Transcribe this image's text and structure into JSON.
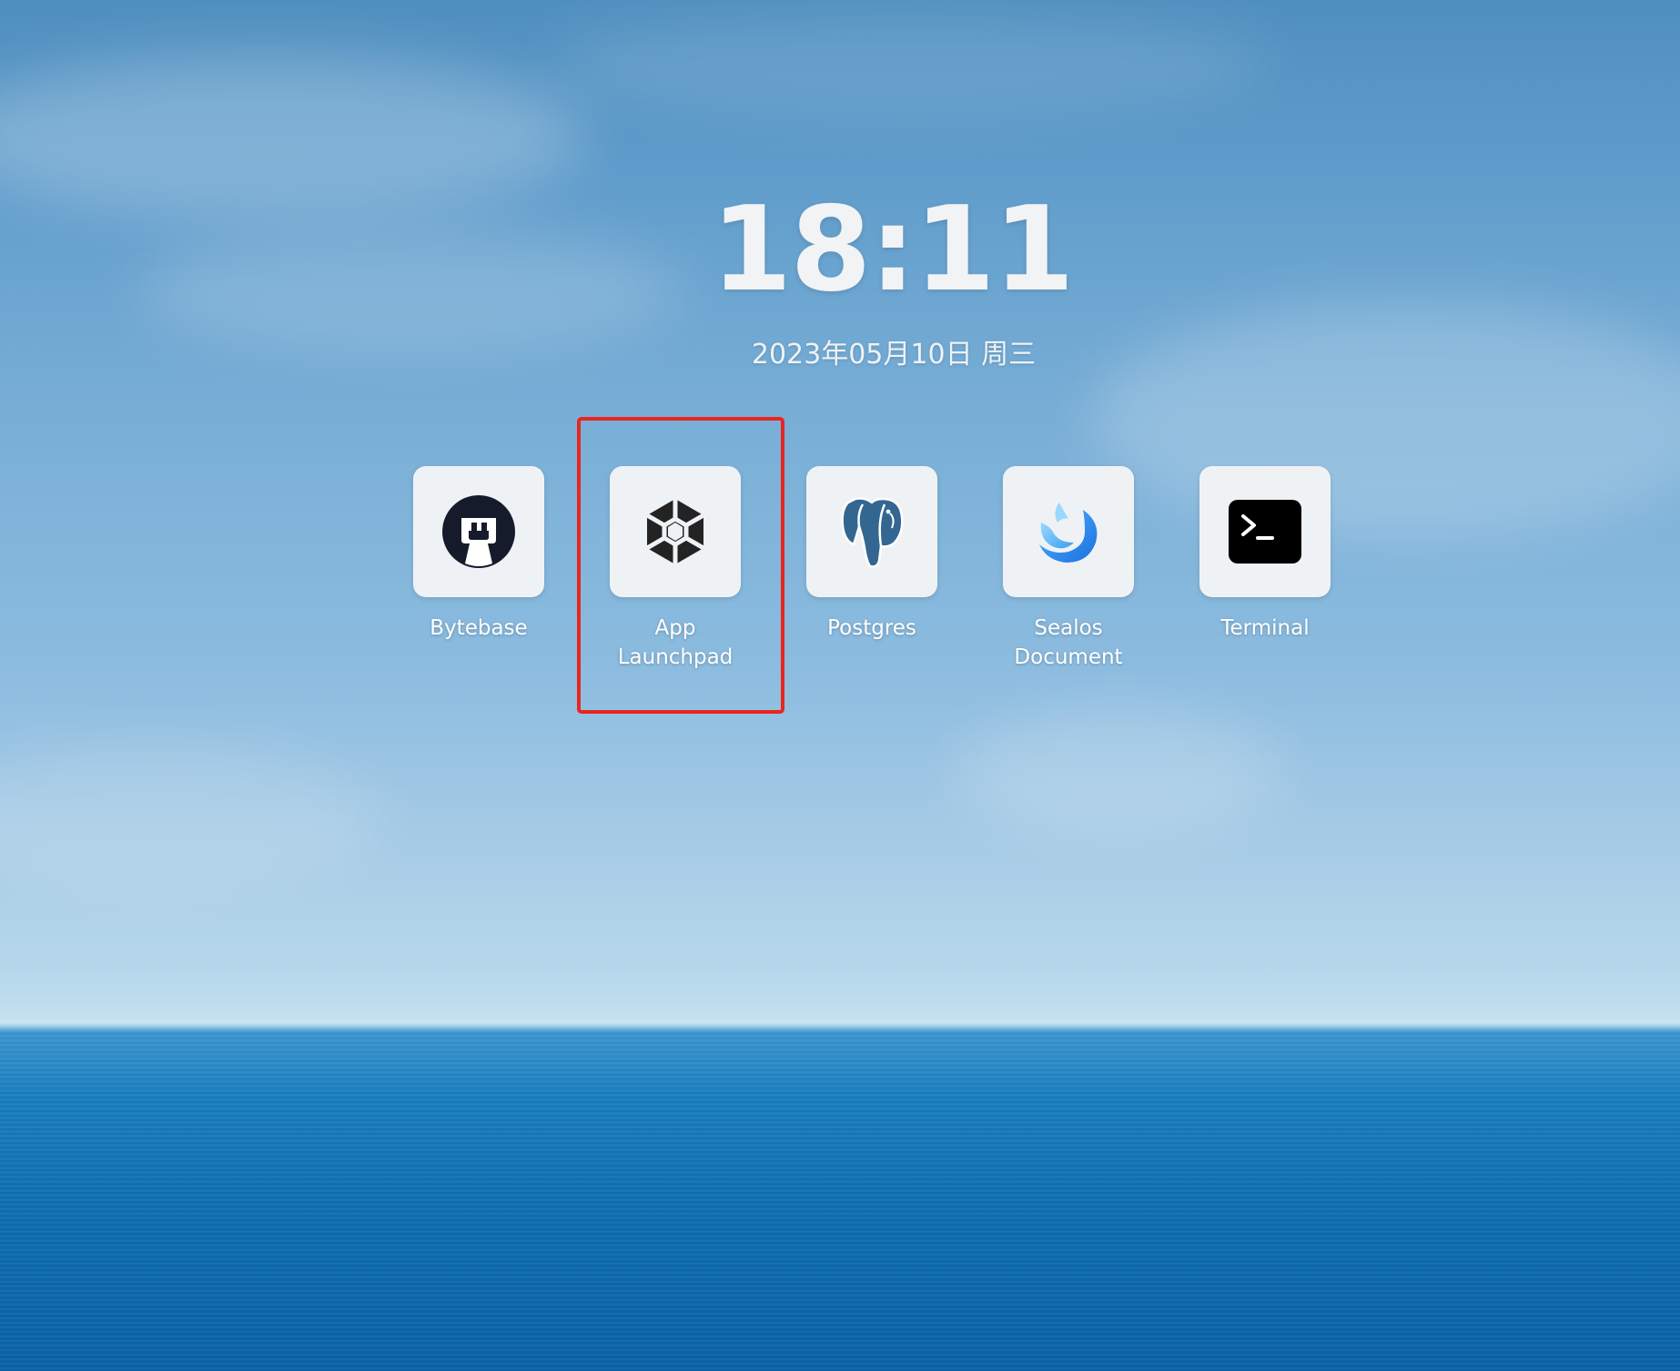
{
  "desktop": {
    "clock": "18:11",
    "date": "2023年05月10日 周三"
  },
  "apps": [
    {
      "label": "Bytebase",
      "icon": "bytebase-icon"
    },
    {
      "label": "App\nLaunchpad",
      "icon": "hexagon-launchpad-icon"
    },
    {
      "label": "Postgres",
      "icon": "postgres-elephant-icon"
    },
    {
      "label": "Sealos\nDocument",
      "icon": "sealos-document-icon"
    },
    {
      "label": "Terminal",
      "icon": "terminal-icon"
    }
  ],
  "colors": {
    "highlight": "#e8251f",
    "tile": "#eff2f5",
    "terminal": "#000000",
    "bytebase": "#161b2c",
    "postgres": "#336791",
    "sealos": "#1e8fe6"
  }
}
